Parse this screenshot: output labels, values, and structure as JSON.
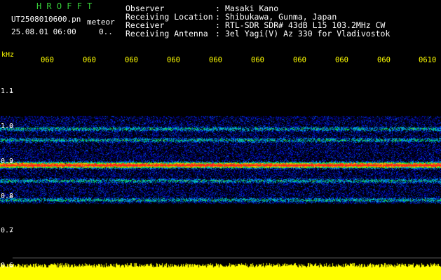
{
  "header": {
    "app_title": "HROFFT",
    "file_name": "UT2508010600.pn",
    "file_tag": "meteor",
    "date_time": "25.08.01 06:00",
    "counter": "0.."
  },
  "info": [
    {
      "label": "Observer",
      "sep": ":",
      "value": "Masaki Kano"
    },
    {
      "label": "Receiving Location",
      "sep": ":",
      "value": "Shibukawa, Gunma, Japan"
    },
    {
      "label": "Receiver",
      "sep": ":",
      "value": "RTL-SDR SDR# 43dB L15 103.2MHz CW"
    },
    {
      "label": "Receiving Antenna",
      "sep": ":",
      "value": "3el Yagi(V) Az 330 for Vladivostok"
    }
  ],
  "axis": {
    "unit": "kHz",
    "freq_ticks": [
      "1.1",
      "1.0",
      "0.9",
      "0.8",
      "0.7",
      "0.6"
    ],
    "time_ticks": [
      "060",
      "060",
      "060",
      "060",
      "060",
      "060",
      "060",
      "060",
      "060",
      "0610"
    ]
  },
  "colors": {
    "title": "#37d13a",
    "axis_text": "#ffff00",
    "info_text": "#ffffff",
    "background": "#000000",
    "echo_bar": "#ffff00",
    "strong_signal": "#ff2a1e"
  },
  "spectrogram": {
    "freq_min": 0.6,
    "freq_max": 1.1,
    "noise_band_khz": [
      1.03,
      0.78
    ],
    "carrier_lines_khz": [
      0.994,
      0.962,
      0.895,
      0.885,
      0.845,
      0.79
    ],
    "strong_line_khz": 0.89
  }
}
